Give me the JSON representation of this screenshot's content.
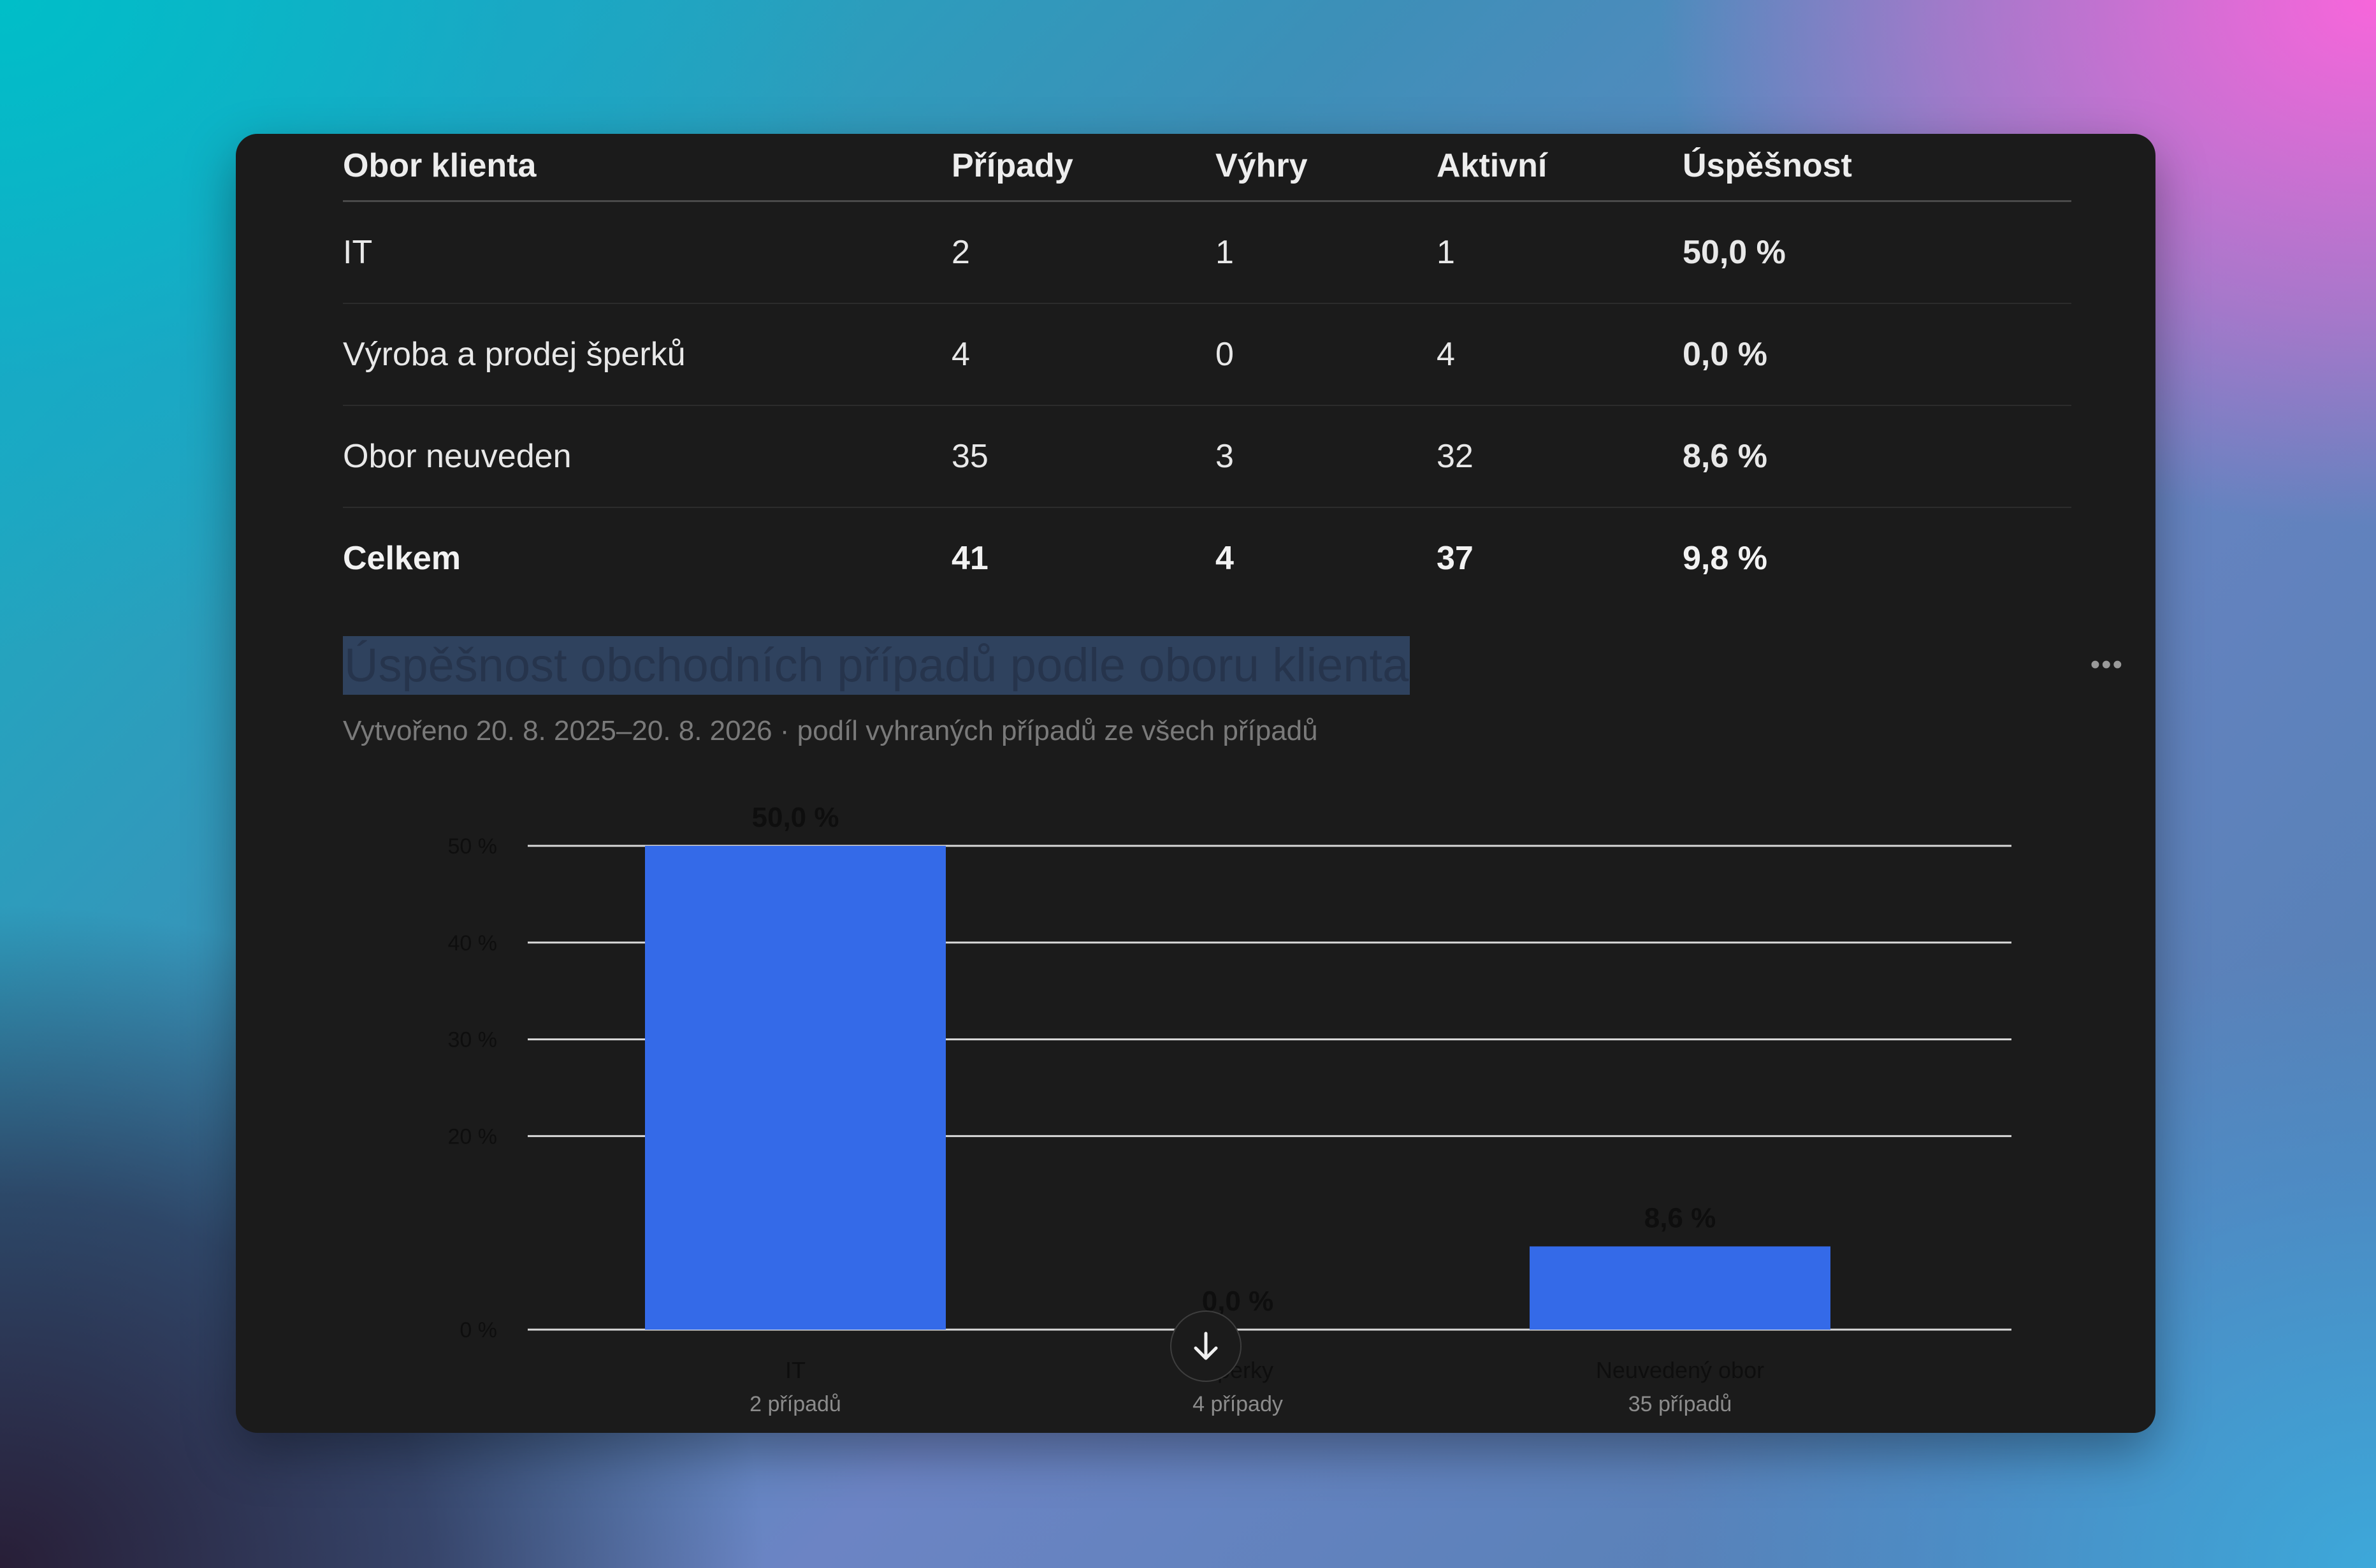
{
  "table": {
    "headers": [
      "Obor klienta",
      "Případy",
      "Výhry",
      "Aktivní",
      "Úspěšnost"
    ],
    "rows": [
      [
        "IT",
        "2",
        "1",
        "1",
        "50,0 %"
      ],
      [
        "Výroba a prodej šperků",
        "4",
        "0",
        "4",
        "0,0 %"
      ],
      [
        "Obor neuveden",
        "35",
        "3",
        "32",
        "8,6 %"
      ]
    ],
    "total": [
      "Celkem",
      "41",
      "4",
      "37",
      "9,8 %"
    ]
  },
  "chart_section": {
    "title": "Úspěšnost obchodních případů podle oboru klienta",
    "subtitle": "Vytvořeno 20. 8. 2025–20. 8. 2026 · podíl vyhraných případů ze všech případů",
    "more_icon": "ellipsis-icon",
    "scroll_icon": "arrow-down-icon"
  },
  "chart_data": {
    "type": "bar",
    "categories": [
      "IT",
      "Šperky",
      "Neuvedený obor"
    ],
    "sublabels": [
      "2 případů",
      "4 případy",
      "35 případů"
    ],
    "values": [
      50.0,
      0.0,
      8.6
    ],
    "value_labels": [
      "50,0 %",
      "0,0 %",
      "8,6 %"
    ],
    "ylim": [
      0,
      50
    ],
    "yticks": [
      0,
      20,
      30,
      40,
      50
    ],
    "ytick_labels": [
      "0 %",
      "20 %",
      "30 %",
      "40 %",
      "50 %"
    ],
    "grid": true,
    "colors": {
      "bar": "#346ae8",
      "grid": "#d9d9d9",
      "label": "#0e0e0e",
      "sublabel": "#8c8c8c"
    }
  }
}
